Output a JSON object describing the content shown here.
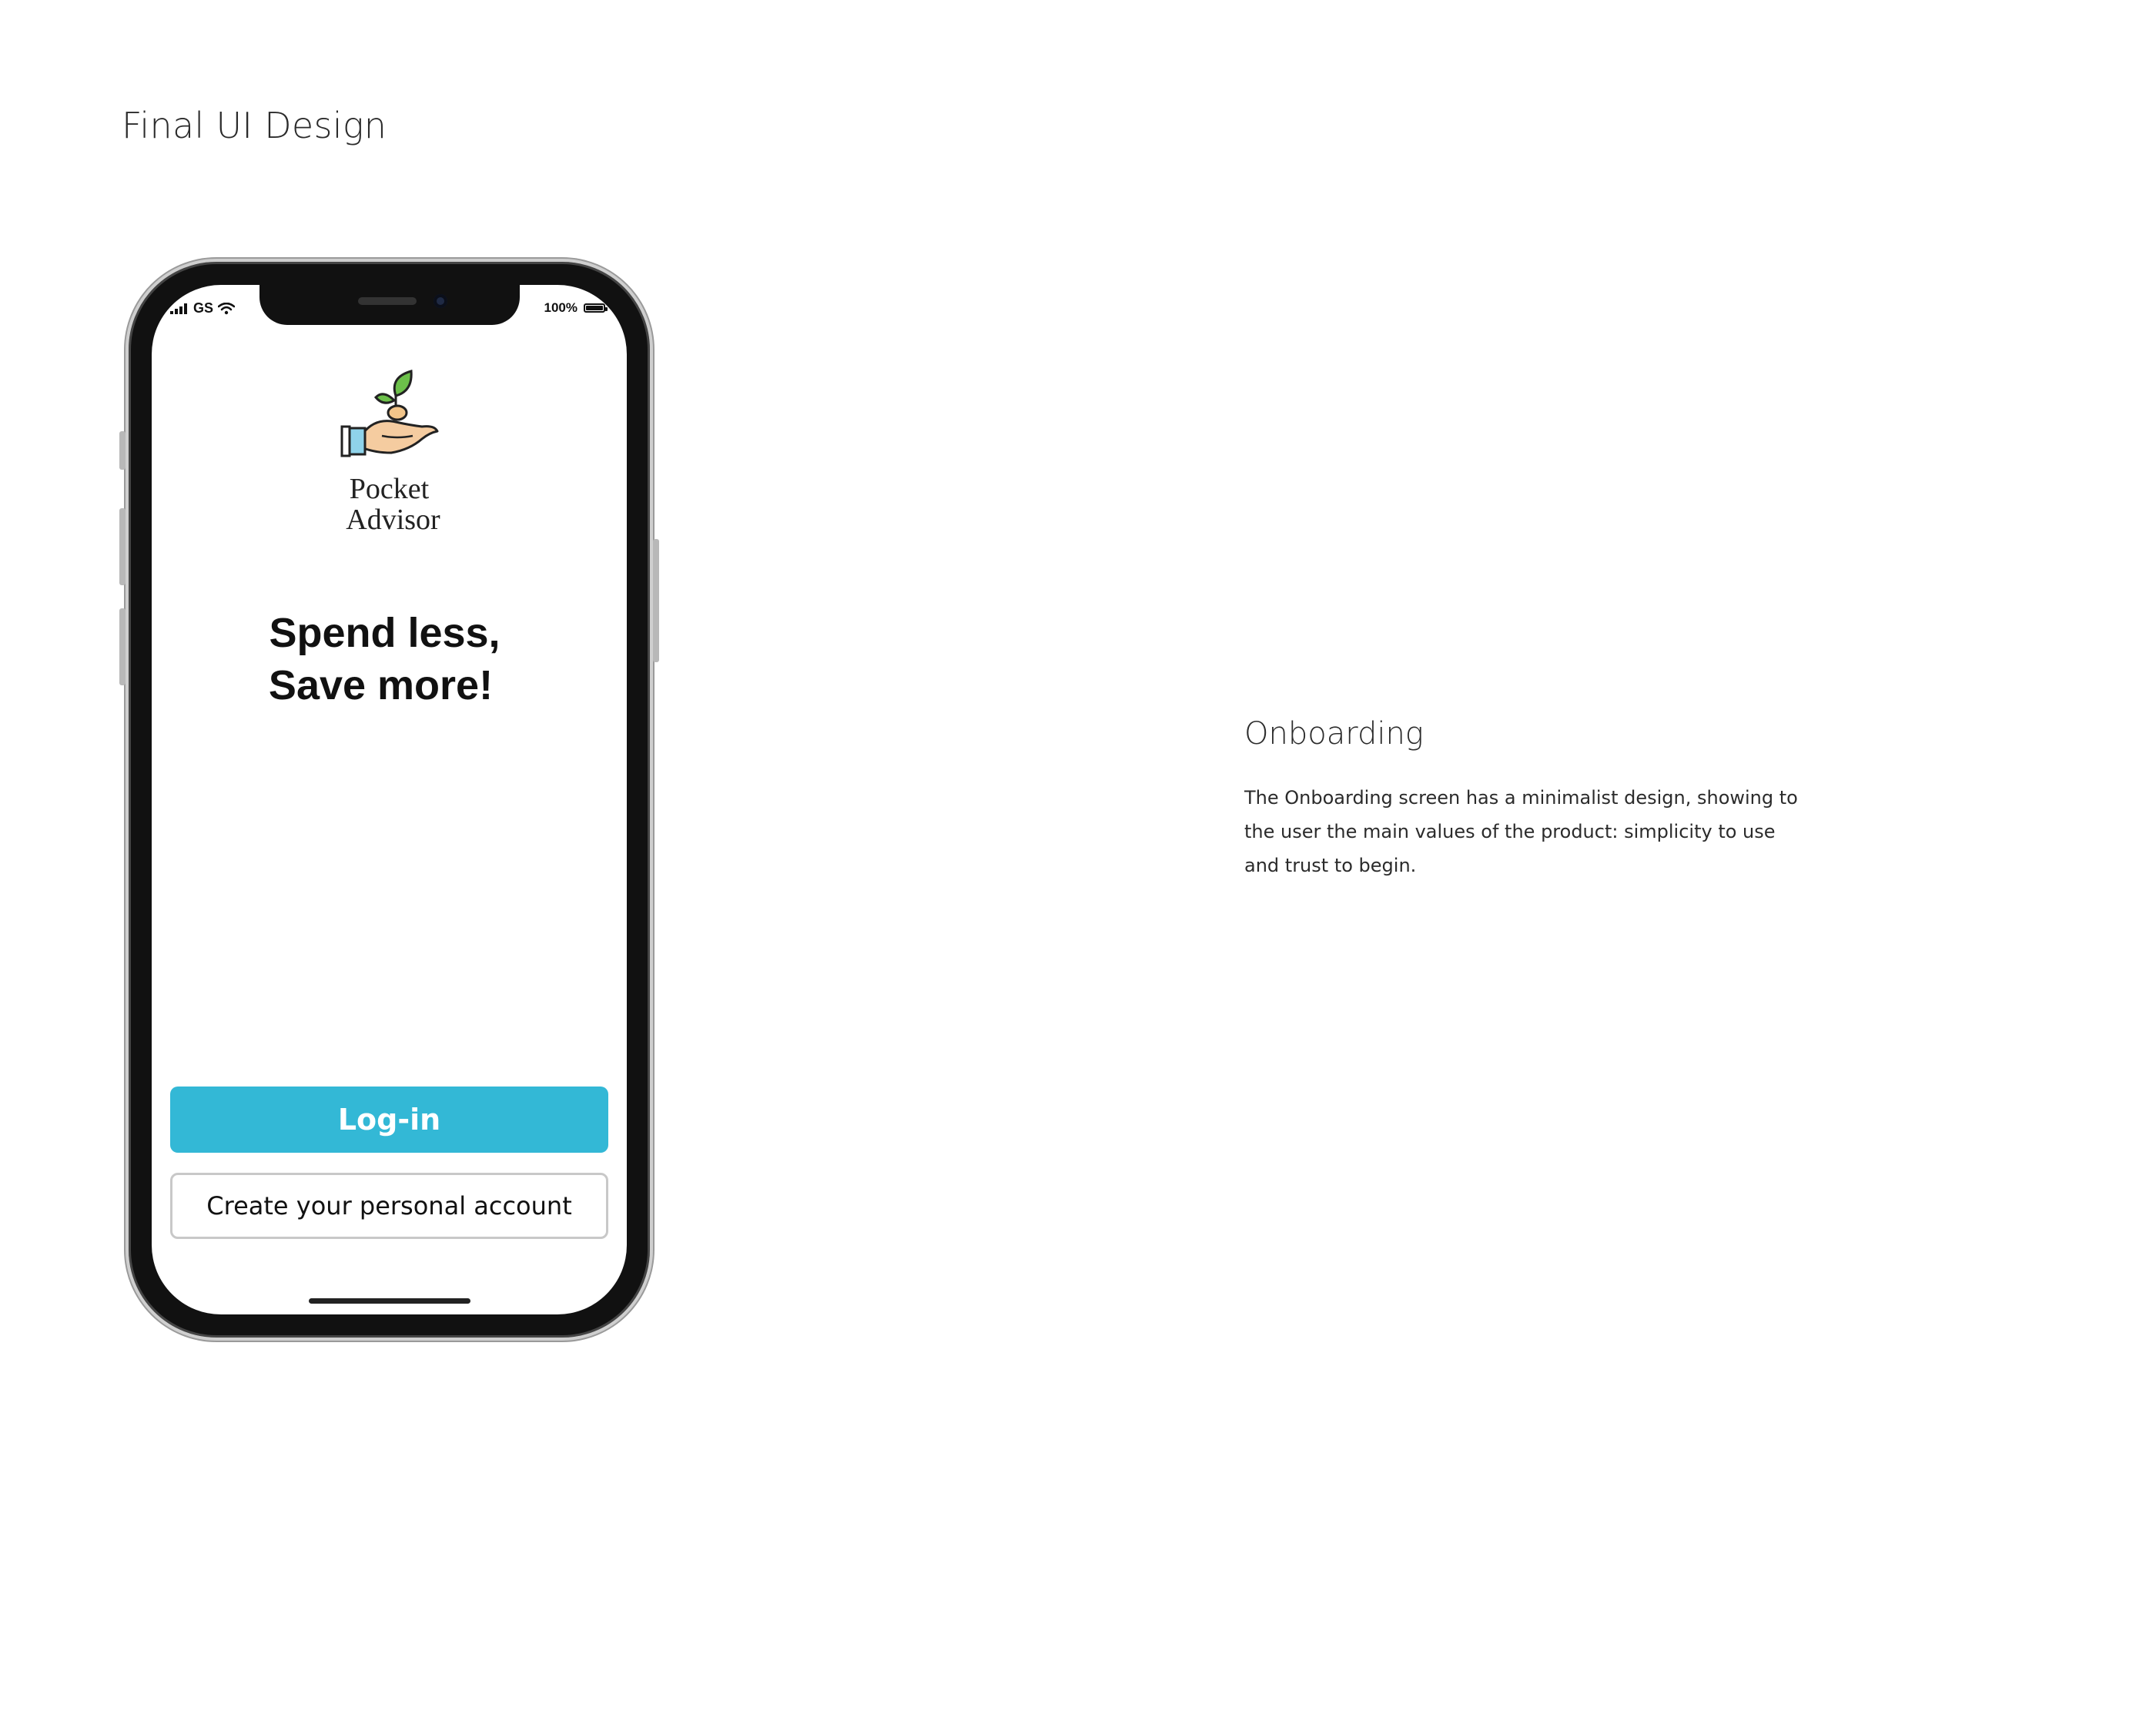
{
  "page": {
    "heading": "Final UI Design"
  },
  "phone": {
    "status_bar": {
      "carrier": "GS",
      "battery": "100%"
    },
    "logo": {
      "line1": "Pocket",
      "line2": "Advisor",
      "icon": "hand-holding-sprout-icon"
    },
    "tagline": {
      "line1": "Spend less,",
      "line2": "Save more!"
    },
    "login_button": "Log-in",
    "create_account_button": "Create your personal account",
    "accent_color": "#33b8d6"
  },
  "description": {
    "title": "Onboarding",
    "body": "The Onboarding screen has a minimalist design, showing to the user the main values of the product: simplicity to use and trust to begin."
  }
}
